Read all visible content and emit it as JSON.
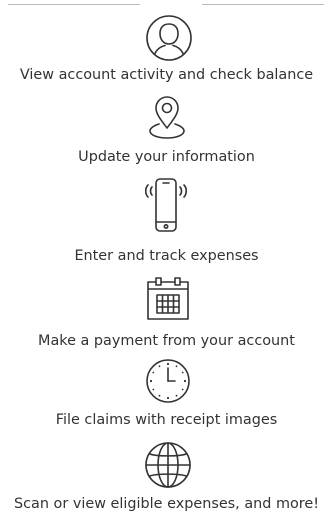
{
  "colors": {
    "text": "#333333",
    "icon_stroke": "#333333",
    "divider": "#bdbdbd"
  },
  "features": [
    {
      "icon": "user-profile-icon",
      "label": "View account activity and check balance"
    },
    {
      "icon": "location-pin-icon",
      "label": "Update your information"
    },
    {
      "icon": "mobile-phone-icon",
      "label": "Enter and track expenses"
    },
    {
      "icon": "calendar-icon",
      "label": "Make a payment from your account"
    },
    {
      "icon": "clock-icon",
      "label": "File claims with receipt images"
    },
    {
      "icon": "globe-icon",
      "label": "Scan or view eligible expenses, and more!"
    }
  ]
}
